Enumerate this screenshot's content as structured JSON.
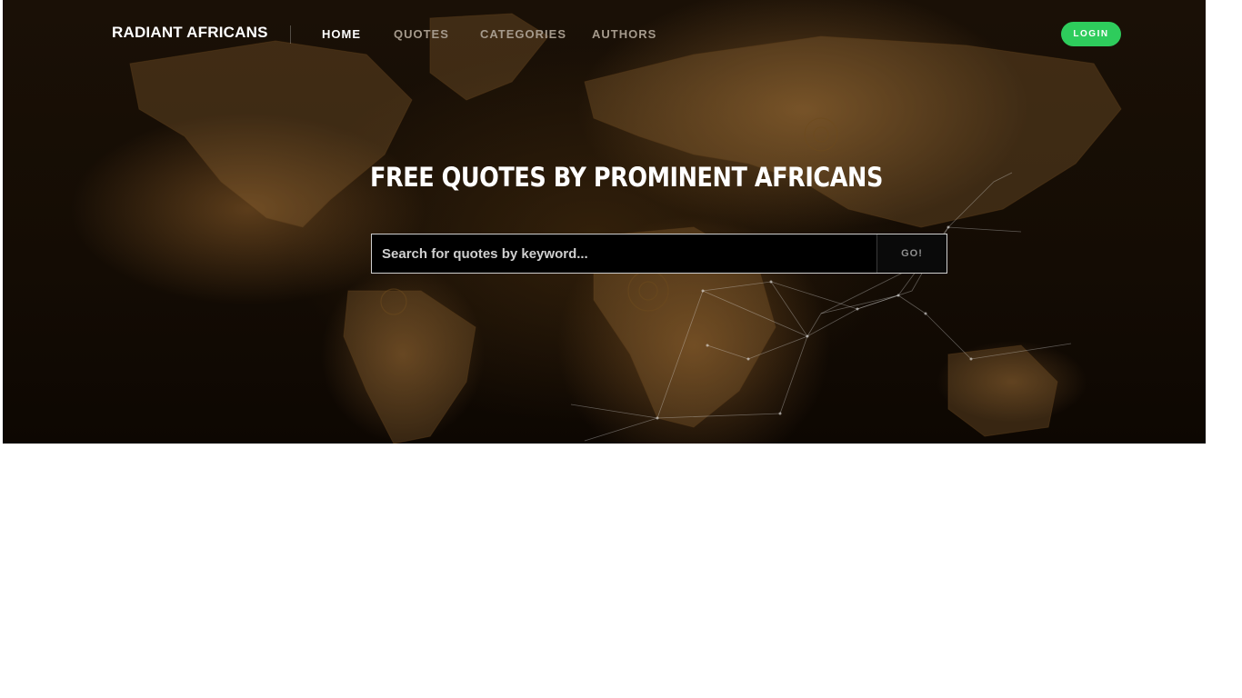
{
  "brand": {
    "name": "RADIANT AFRICANS"
  },
  "nav": {
    "items": [
      {
        "label": "HOME",
        "active": true
      },
      {
        "label": "QUOTES",
        "active": false
      },
      {
        "label": "CATEGORIES",
        "active": false
      },
      {
        "label": "AUTHORS",
        "active": false
      }
    ],
    "login_label": "LOGIN"
  },
  "hero": {
    "headline": "FREE QUOTES BY PROMINENT AFRICANS",
    "background": "world-map-texture"
  },
  "search": {
    "placeholder": "Search for quotes by keyword...",
    "value": "",
    "button_label": "GO!"
  },
  "colors": {
    "accent_green": "#2ecc5c",
    "nav_inactive": "#a59a8c",
    "nav_active": "#ffffff"
  }
}
